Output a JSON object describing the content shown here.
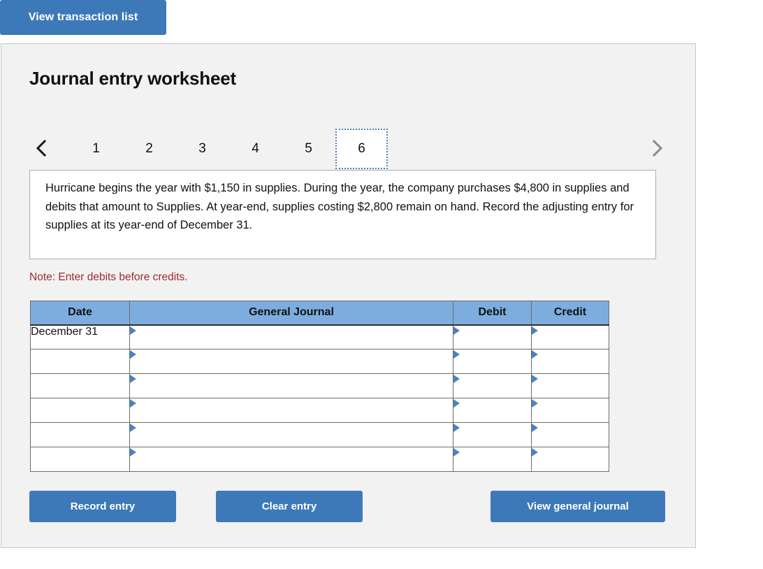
{
  "top_bar": {
    "view_transaction_list_label": "View transaction list"
  },
  "panel": {
    "title": "Journal entry worksheet",
    "note": "Note: Enter debits before credits.",
    "instruction": "Hurricane begins the year with $1,150 in supplies. During the year, the company purchases $4,800 in supplies and debits that amount to Supplies. At year-end, supplies costing $2,800 remain on hand. Record the adjusting entry for supplies at its year-end of December 31."
  },
  "pagination": {
    "prev_icon": "chevron-left-icon",
    "next_icon": "chevron-right-icon",
    "tabs": [
      {
        "label": "1",
        "selected": false
      },
      {
        "label": "2",
        "selected": false
      },
      {
        "label": "3",
        "selected": false
      },
      {
        "label": "4",
        "selected": false
      },
      {
        "label": "5",
        "selected": false
      },
      {
        "label": "6",
        "selected": true
      }
    ]
  },
  "journal_table": {
    "headers": [
      "Date",
      "General Journal",
      "Debit",
      "Credit"
    ],
    "rows": [
      {
        "date": "December 31",
        "general_journal": "",
        "debit": "",
        "credit": ""
      },
      {
        "date": "",
        "general_journal": "",
        "debit": "",
        "credit": ""
      },
      {
        "date": "",
        "general_journal": "",
        "debit": "",
        "credit": ""
      },
      {
        "date": "",
        "general_journal": "",
        "debit": "",
        "credit": ""
      },
      {
        "date": "",
        "general_journal": "",
        "debit": "",
        "credit": ""
      },
      {
        "date": "",
        "general_journal": "",
        "debit": "",
        "credit": ""
      }
    ]
  },
  "actions": {
    "record_entry_label": "Record entry",
    "clear_entry_label": "Clear entry",
    "view_general_journal_label": "View general journal"
  },
  "colors": {
    "button_blue": "#3d79b8",
    "table_header_blue": "#7cadde",
    "note_red": "#a02c2c",
    "panel_background": "#f2f2f2",
    "marker_blue": "#4a82c3",
    "focus_border_blue": "#4a7fc1"
  }
}
